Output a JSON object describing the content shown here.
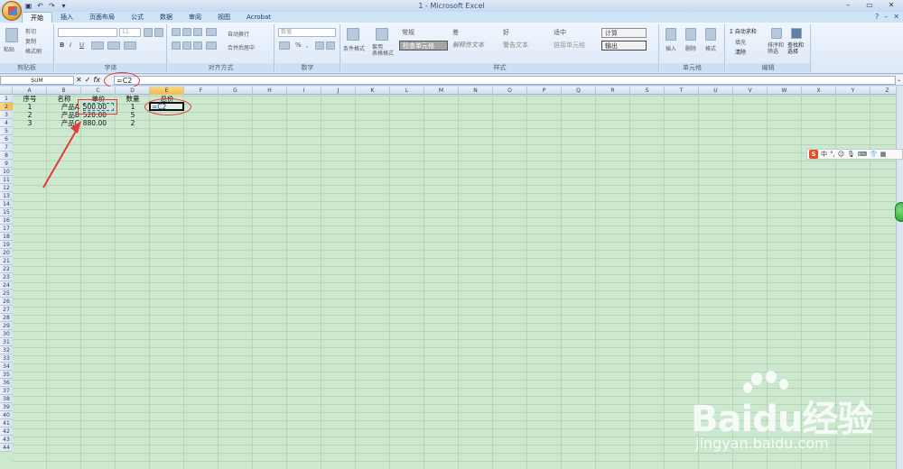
{
  "window": {
    "title": "1 - Microsoft Excel",
    "min": "–",
    "restore": "▭",
    "close": "✕"
  },
  "office_button_name": "office-orb-icon",
  "qat": {
    "save": "▣",
    "undo": "↶",
    "redo": "↷",
    "more": "▾"
  },
  "tabs": [
    "开始",
    "插入",
    "页面布局",
    "公式",
    "数据",
    "审阅",
    "视图",
    "Acrobat"
  ],
  "help": {
    "help_icon": "?",
    "min": "–",
    "close": "✕"
  },
  "ribbon": {
    "clipboard": {
      "label": "剪贴板",
      "paste": "粘贴",
      "cut": "剪切",
      "copy": "复制",
      "format_painter": "格式刷"
    },
    "font": {
      "label": "字体",
      "size": "11",
      "bold": "B",
      "italic": "I",
      "underline": "U"
    },
    "alignment": {
      "label": "对齐方式",
      "wrap": "自动换行",
      "merge": "合并后居中"
    },
    "number": {
      "label": "数字",
      "format": "数值",
      "percent": "%",
      "comma": ","
    },
    "styles": {
      "label": "样式",
      "cond_format": "条件格式",
      "table_format": "套用\n表格格式",
      "normal": "常规",
      "bad": "差",
      "good": "好",
      "neutral": "适中",
      "calc": "计算",
      "check_cell": "检查单元格",
      "explanatory": "解释性文本",
      "warning": "警告文本",
      "linked": "链接单元格",
      "output": "输出"
    },
    "cells": {
      "label": "单元格",
      "insert": "插入",
      "delete": "删除",
      "format": "格式"
    },
    "editing": {
      "label": "编辑",
      "autosum": "自动求和",
      "fill": "填充",
      "clear": "清除",
      "sort": "排序和\n筛选",
      "find": "查找和\n选择"
    }
  },
  "formula_bar": {
    "name_box": "SUM",
    "cancel": "✕",
    "enter": "✓",
    "fx": "fx",
    "formula": "=C2"
  },
  "columns": [
    "A",
    "B",
    "C",
    "D",
    "E",
    "F",
    "G",
    "H",
    "I",
    "J",
    "K",
    "L",
    "M",
    "N",
    "O",
    "P",
    "Q",
    "R",
    "S",
    "T",
    "U",
    "V",
    "W",
    "X",
    "Y",
    "Z"
  ],
  "rows": [
    "1",
    "2",
    "3",
    "4",
    "5",
    "6",
    "7",
    "8",
    "9",
    "10",
    "11",
    "12",
    "13",
    "14",
    "15",
    "16",
    "17",
    "18",
    "19",
    "20",
    "21",
    "22",
    "23",
    "24",
    "25",
    "26",
    "27",
    "28",
    "29",
    "30",
    "31",
    "32",
    "33",
    "34",
    "35",
    "36",
    "37",
    "38",
    "39",
    "40",
    "41",
    "42",
    "43",
    "44"
  ],
  "sheet": {
    "headers": {
      "A": "序号",
      "B": "名称",
      "C": "单价",
      "D": "数量",
      "E": "总价"
    },
    "rows": [
      {
        "A": "1",
        "B": "产品A",
        "C": "500.00",
        "D": "1",
        "E": "=C2"
      },
      {
        "A": "2",
        "B": "产品B",
        "C": "520.00",
        "D": "5"
      },
      {
        "A": "3",
        "B": "产品C",
        "C": "880.00",
        "D": "2"
      }
    ]
  },
  "ime": {
    "logo": "S",
    "lang": "中",
    "punct": "°,",
    "emoji": "☺",
    "mic": "🎙",
    "keyboard": "⌨",
    "skin": "👕",
    "tools": "▦"
  },
  "watermark": {
    "main": "Baidu经验",
    "sub": "jingyan.baidu.com"
  }
}
